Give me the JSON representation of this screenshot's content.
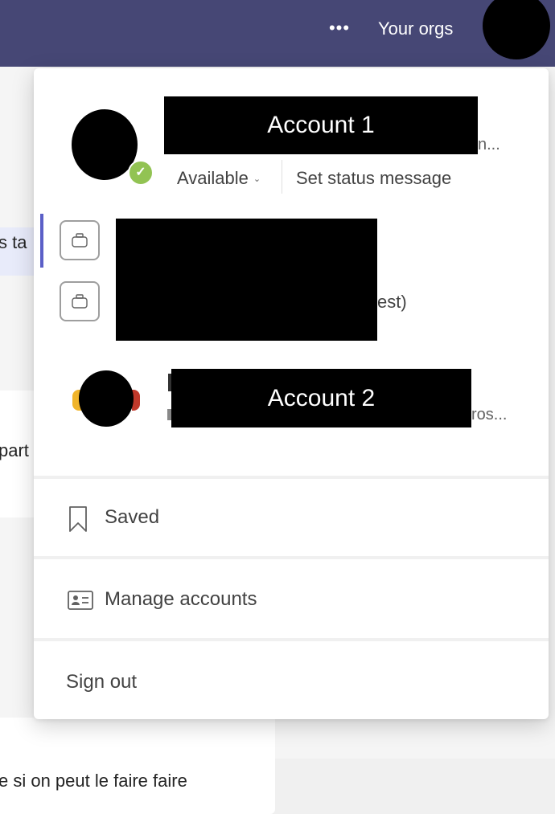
{
  "header": {
    "more_label": "•••",
    "your_orgs_label": "Your orgs",
    "profile_avatar": "avatar (redacted)"
  },
  "background": {
    "fragment_1": "s ta",
    "fragment_2": "part",
    "fragment_3": "e si on peut le faire faire"
  },
  "popup": {
    "account_1": {
      "name": "Account 1",
      "email_tail": "n...",
      "status": "Available",
      "status_chevron": "⌄",
      "presence_icon": "✓",
      "set_status_label": "Set status message"
    },
    "orgs": [
      {
        "icon": "briefcase-icon",
        "selected": true
      },
      {
        "icon": "briefcase-icon",
        "selected": false,
        "name_tail": "est)"
      }
    ],
    "account_2": {
      "name": "Account 2",
      "email_tail": "ros..."
    },
    "menu": [
      {
        "icon": "bookmark-icon",
        "label": "Saved"
      },
      {
        "icon": "contact-card-icon",
        "label": "Manage accounts"
      },
      {
        "label": "Sign out"
      }
    ]
  },
  "colors": {
    "header_bg": "#464775",
    "accent": "#5b5fc7",
    "presence_available": "#92c353"
  }
}
